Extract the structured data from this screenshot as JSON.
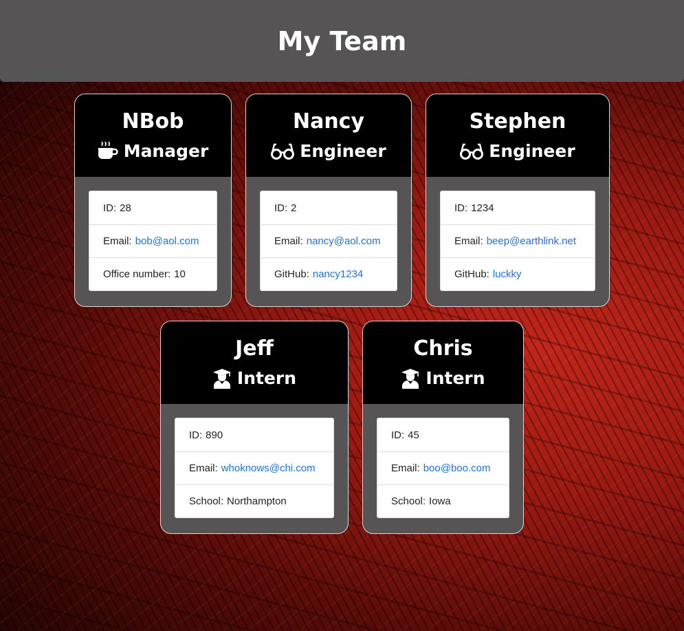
{
  "header": {
    "title": "My Team"
  },
  "team": [
    {
      "name": "NBob",
      "role": "Manager",
      "icon": "coffee-icon",
      "id_label": "ID:",
      "id": "28",
      "email_label": "Email:",
      "email": "bob@aol.com",
      "extra_label": "Office number:",
      "extra": "10",
      "extra_is_link": false
    },
    {
      "name": "Nancy",
      "role": "Engineer",
      "icon": "glasses-icon",
      "id_label": "ID:",
      "id": "2",
      "email_label": "Email:",
      "email": "nancy@aol.com",
      "extra_label": "GitHub:",
      "extra": "nancy1234",
      "extra_is_link": true
    },
    {
      "name": "Stephen",
      "role": "Engineer",
      "icon": "glasses-icon",
      "id_label": "ID:",
      "id": "1234",
      "email_label": "Email:",
      "email": "beep@earthlink.net",
      "extra_label": "GitHub:",
      "extra": "luckky",
      "extra_is_link": true
    },
    {
      "name": "Jeff",
      "role": "Intern",
      "icon": "graduate-icon",
      "id_label": "ID:",
      "id": "890",
      "email_label": "Email:",
      "email": "whoknows@chi.com",
      "extra_label": "School:",
      "extra": "Northampton",
      "extra_is_link": false
    },
    {
      "name": "Chris",
      "role": "Intern",
      "icon": "graduate-icon",
      "id_label": "ID:",
      "id": "45",
      "email_label": "Email:",
      "email": "boo@boo.com",
      "extra_label": "School:",
      "extra": "Iowa",
      "extra_is_link": false
    }
  ],
  "colors": {
    "header_bg": "#565455",
    "card_head_bg": "#000000",
    "link": "#1a73e8"
  }
}
